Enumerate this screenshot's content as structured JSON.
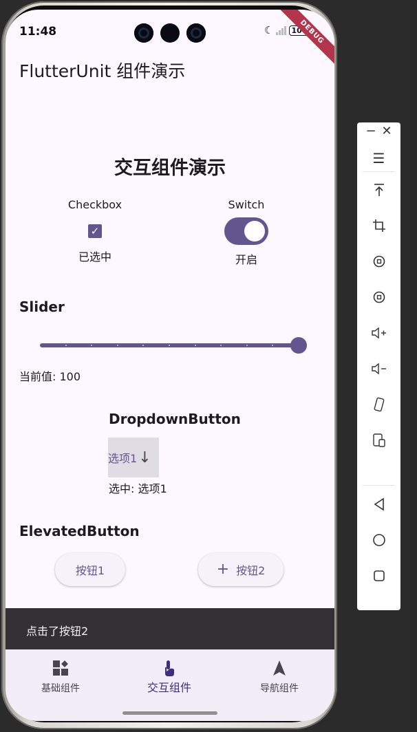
{
  "status_bar": {
    "time": "11:48",
    "battery": "100",
    "signal_label": "×"
  },
  "debug_banner": "DEBUG",
  "app_bar": {
    "title": "FlutterUnit 组件演示"
  },
  "page": {
    "section_title": "交互组件演示",
    "checkbox": {
      "label": "Checkbox",
      "checked": true,
      "state_text": "已选中"
    },
    "switch": {
      "label": "Switch",
      "on": true,
      "state_text": "开启"
    },
    "slider": {
      "heading": "Slider",
      "value": 100,
      "min": 0,
      "max": 100,
      "divisions": 10,
      "value_text": "当前值: 100"
    },
    "dropdown": {
      "heading": "DropdownButton",
      "selected_value": "选项1",
      "selected_text": "选中: 选项1"
    },
    "elevated": {
      "heading": "ElevatedButton",
      "button1_label": "按钮1",
      "button2_label": "按钮2"
    }
  },
  "snackbar": {
    "message": "点击了按钮2"
  },
  "bottom_nav": {
    "items": [
      {
        "label": "基础组件",
        "icon": "widgets-icon",
        "selected": false
      },
      {
        "label": "交互组件",
        "icon": "touch-app-icon",
        "selected": true
      },
      {
        "label": "导航组件",
        "icon": "navigation-icon",
        "selected": false
      }
    ]
  },
  "colors": {
    "primary": "#65558f",
    "surface": "#fdf7ff",
    "snackbar": "#322f35",
    "nav_background": "#f3edf7",
    "debug_banner": "#b3354b"
  },
  "emulator_toolbar": {
    "icons": [
      "minimize-icon",
      "close-icon",
      "menu-icon",
      "pin-top-icon",
      "crop-icon",
      "rotate-left-icon",
      "rotate-right-icon",
      "volume-up-icon",
      "volume-down-icon",
      "shake-icon",
      "screenshot-icon",
      "back-icon",
      "home-icon",
      "overview-icon"
    ]
  }
}
